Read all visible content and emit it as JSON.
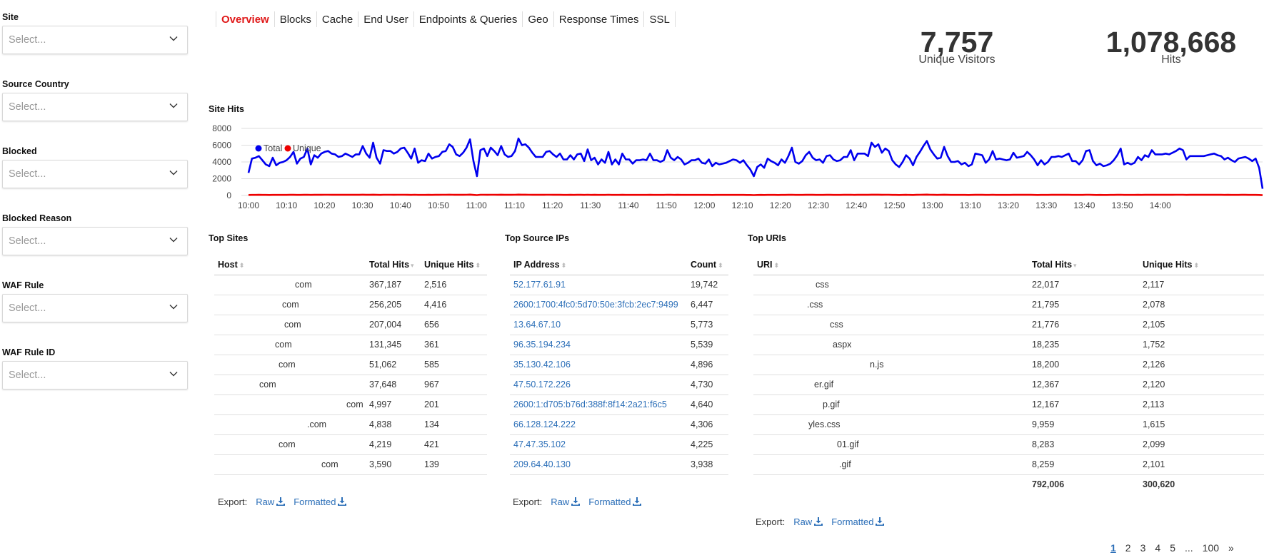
{
  "filters": [
    {
      "label": "Site",
      "placeholder": "Select..."
    },
    {
      "label": "Source Country",
      "placeholder": "Select..."
    },
    {
      "label": "Blocked",
      "placeholder": "Select..."
    },
    {
      "label": "Blocked Reason",
      "placeholder": "Select..."
    },
    {
      "label": "WAF Rule",
      "placeholder": "Select..."
    },
    {
      "label": "WAF Rule ID",
      "placeholder": "Select..."
    }
  ],
  "tabs": [
    "Overview",
    "Blocks",
    "Cache",
    "End User",
    "Endpoints & Queries",
    "Geo",
    "Response Times",
    "SSL"
  ],
  "kpis": {
    "visitors": {
      "value": "7,757",
      "label": "Unique Visitors"
    },
    "hits": {
      "value": "1,078,668",
      "label": "Hits"
    }
  },
  "chart_title": "Site Hits",
  "chart_data": {
    "type": "line",
    "ylim": [
      0,
      8000
    ],
    "yticks": [
      "8000",
      "6000",
      "4000",
      "2000",
      "0"
    ],
    "xticks": [
      "10:00",
      "10:10",
      "10:20",
      "10:30",
      "10:40",
      "10:50",
      "11:00",
      "11:10",
      "11:20",
      "11:30",
      "11:40",
      "11:50",
      "12:00",
      "12:10",
      "12:20",
      "12:30",
      "12:40",
      "12:50",
      "13:00",
      "13:10",
      "13:20",
      "13:30",
      "13:40",
      "13:50",
      "14:00"
    ],
    "grid": "horizontal",
    "legend": "top-left",
    "series": [
      {
        "name": "Total",
        "color": "#0000ee",
        "values": [
          2700,
          4400,
          4500,
          4700,
          4200,
          3700,
          3500,
          4500,
          3600,
          3900,
          4000,
          4200,
          4600,
          5200,
          3800,
          4400,
          4600,
          5600,
          3700,
          4800,
          4500,
          5000,
          5200,
          5300,
          5000,
          4900,
          4600,
          4700,
          5000,
          4800,
          4600,
          4900,
          4900,
          5900,
          5000,
          4500,
          6300,
          4500,
          3800,
          5400,
          5300,
          5300,
          5000,
          5200,
          5600,
          5700,
          5100,
          4400,
          5600,
          3900,
          4200,
          4100,
          5000,
          4400,
          4600,
          4700,
          5200,
          5300,
          6100,
          5800,
          4900,
          4700,
          5100,
          5700,
          6700,
          4100,
          2300,
          5400,
          5600,
          4700,
          5700,
          5300,
          4800,
          5900,
          4900,
          4600,
          4700,
          5300,
          6800,
          6000,
          6100,
          5700,
          5100,
          4600,
          4600,
          4600,
          5200,
          5300,
          4900,
          4600,
          5000,
          4300,
          4300,
          4800,
          4300,
          4900,
          5000,
          4100,
          5500,
          4200,
          4500,
          3700,
          4300,
          3900,
          5200,
          3700,
          4300,
          3700,
          5000,
          4300,
          4300,
          3800,
          4200,
          4200,
          4300,
          4200,
          5000,
          4200,
          4200,
          4000,
          4200,
          5400,
          4500,
          4200,
          4600,
          4300,
          3700,
          3900,
          4200,
          4200,
          4400,
          3900,
          3800,
          4300,
          3500,
          3900,
          3700,
          3800,
          3900,
          4100,
          4300,
          4200,
          3900,
          4200,
          3600,
          3100,
          2300,
          3400,
          3700,
          3300,
          4400,
          4100,
          3900,
          3600,
          4300,
          3900,
          4700,
          5700,
          4000,
          3800,
          4100,
          4800,
          5200,
          4500,
          4200,
          4300,
          3900,
          4700,
          4800,
          4300,
          4100,
          4200,
          4600,
          4600,
          5400,
          4200,
          5000,
          5000,
          5000,
          4700,
          6300,
          5800,
          6100,
          5100,
          5600,
          5300,
          4200,
          3700,
          3400,
          4000,
          4800,
          4400,
          3600,
          4600,
          5200,
          5900,
          6500,
          5500,
          4900,
          4400,
          4500,
          5800,
          4700,
          4000,
          4000,
          4100,
          3700,
          3900,
          3500,
          3700,
          5000,
          4900,
          4800,
          3900,
          4300,
          5300,
          4300,
          4400,
          4300,
          4200,
          4300,
          5100,
          4500,
          4600,
          4700,
          5200,
          4800,
          4300,
          3600,
          4200,
          3700,
          4000,
          4600,
          4600,
          4700,
          4600,
          4800,
          5000,
          4100,
          4100,
          3700,
          4200,
          5300,
          5400,
          4100,
          3600,
          3800,
          3500,
          3600,
          3800,
          4200,
          4800,
          5600,
          3700,
          3900,
          3700,
          3900,
          4600,
          4200,
          4800,
          4600,
          5400,
          4900,
          4900,
          4900,
          5000,
          4900,
          5100,
          5300,
          5600,
          5400,
          4300,
          4700,
          4700,
          4700,
          4700,
          4700,
          4800,
          4900,
          5000,
          4800,
          4700,
          4300,
          4500,
          4200,
          4000,
          4400,
          4500,
          4600,
          4400,
          4100,
          4400,
          3300,
          800
        ]
      },
      {
        "name": "Unique",
        "color": "#ee0000",
        "values": [
          60,
          70,
          70,
          75,
          70,
          65,
          60,
          70,
          65,
          70,
          70,
          72,
          75,
          80,
          65,
          72,
          75,
          85,
          65,
          78,
          75,
          80,
          82,
          85,
          80,
          78,
          75,
          76,
          80,
          78,
          75,
          78,
          78,
          90,
          80,
          74,
          95,
          74,
          66,
          84,
          82,
          82,
          80,
          82,
          86,
          88,
          80,
          72,
          86,
          66,
          70,
          70,
          80,
          72,
          75,
          76,
          82,
          84,
          92,
          88,
          78,
          76,
          80,
          88,
          98,
          70,
          45,
          84,
          86,
          76,
          88,
          84,
          78,
          90,
          78,
          75,
          76,
          84,
          100,
          92,
          92,
          88,
          80,
          75,
          75,
          75,
          82,
          84,
          78,
          75,
          80,
          72,
          72,
          78,
          72,
          78,
          80,
          70,
          85,
          70,
          74,
          64,
          72,
          66,
          82,
          64,
          72,
          64,
          80,
          72,
          72,
          66,
          70,
          70,
          72,
          70,
          80,
          70,
          70,
          68,
          70,
          84,
          74,
          70,
          75,
          72,
          64,
          66,
          70,
          70,
          72,
          66,
          66,
          72,
          62,
          66,
          64,
          66,
          66,
          68,
          72,
          70,
          66,
          70,
          62,
          56,
          45,
          60,
          64,
          58,
          72,
          68,
          66,
          62,
          72,
          66,
          76,
          88,
          68,
          66,
          68,
          78,
          82,
          74,
          70,
          72,
          66,
          76,
          78,
          72,
          68,
          70,
          75,
          75,
          84,
          70,
          80,
          80,
          80,
          76,
          96,
          90,
          92,
          80,
          86,
          82,
          70,
          64,
          60,
          68,
          78,
          72,
          62,
          75,
          82,
          90,
          98,
          86,
          78,
          72,
          74,
          90,
          76,
          68,
          68,
          68,
          64,
          66,
          62,
          64,
          80,
          78,
          78,
          66,
          72,
          84,
          72,
          72,
          72,
          70,
          72,
          80,
          74,
          75,
          76,
          82,
          78,
          72,
          62,
          70,
          64,
          68,
          75,
          75,
          76,
          75,
          78,
          80,
          68,
          68,
          64,
          70,
          84,
          84,
          68,
          62,
          65,
          62,
          62,
          65,
          70,
          78,
          86,
          64,
          66,
          64,
          66,
          75,
          70,
          78,
          75,
          84,
          78,
          78,
          78,
          80,
          78,
          80,
          84,
          86,
          84,
          72,
          76,
          76,
          76,
          76,
          76,
          78,
          78,
          80,
          78,
          76,
          72,
          74,
          70,
          68,
          72,
          74,
          75,
          72,
          68,
          72,
          58,
          30
        ]
      }
    ]
  },
  "top_sites": {
    "title": "Top Sites",
    "headers": [
      "Host",
      "Total Hits",
      "Unique Hits"
    ],
    "rows": [
      [
        "com",
        "367,187",
        "2,516"
      ],
      [
        "com",
        "256,205",
        "4,416"
      ],
      [
        "com",
        "207,004",
        "656"
      ],
      [
        "com",
        "131,345",
        "361"
      ],
      [
        "com",
        "51,062",
        "585"
      ],
      [
        "com",
        "37,648",
        "967"
      ],
      [
        "com",
        "4,997",
        "201"
      ],
      [
        ".com",
        "4,838",
        "134"
      ],
      [
        "com",
        "4,219",
        "421"
      ],
      [
        "com",
        "3,590",
        "139"
      ]
    ],
    "host_offsets": [
      108,
      90,
      93,
      80,
      85,
      58,
      180,
      125,
      85,
      145
    ]
  },
  "top_ips": {
    "title": "Top Source IPs",
    "headers": [
      "IP Address",
      "Count"
    ],
    "rows": [
      [
        "52.177.61.91",
        "19,742"
      ],
      [
        "2600:1700:4fc0:5d70:50e:3fcb:2ec7:9499",
        "6,447"
      ],
      [
        "13.64.67.10",
        "5,773"
      ],
      [
        "96.35.194.234",
        "5,539"
      ],
      [
        "35.130.42.106",
        "4,896"
      ],
      [
        "47.50.172.226",
        "4,730"
      ],
      [
        "2600:1:d705:b76d:388f:8f14:2a21:f6c5",
        "4,640"
      ],
      [
        "66.128.124.222",
        "4,306"
      ],
      [
        "47.47.35.102",
        "4,225"
      ],
      [
        "209.64.40.130",
        "3,938"
      ]
    ]
  },
  "top_uris": {
    "title": "Top URIs",
    "headers": [
      "URI",
      "Total Hits",
      "Unique Hits"
    ],
    "rows": [
      [
        "css",
        "22,017",
        "2,117"
      ],
      [
        ".css",
        "21,795",
        "2,078"
      ],
      [
        "css",
        "21,776",
        "2,105"
      ],
      [
        "aspx",
        "18,235",
        "1,752"
      ],
      [
        "n.js",
        "18,200",
        "2,126"
      ],
      [
        "er.gif",
        "12,367",
        "2,120"
      ],
      [
        "p.gif",
        "12,167",
        "2,113"
      ],
      [
        "yles.css",
        "9,959",
        "1,615"
      ],
      [
        "01.gif",
        "8,283",
        "2,099"
      ],
      [
        ".gif",
        "8,259",
        "2,101"
      ]
    ],
    "uri_offsets": [
      82,
      70,
      102,
      106,
      158,
      80,
      92,
      72,
      112,
      115
    ],
    "totals": [
      "792,006",
      "300,620"
    ]
  },
  "export": {
    "label": "Export:",
    "raw": "Raw",
    "formatted": "Formatted"
  },
  "pager": [
    "1",
    "2",
    "3",
    "4",
    "5",
    "...",
    "100",
    "»"
  ]
}
